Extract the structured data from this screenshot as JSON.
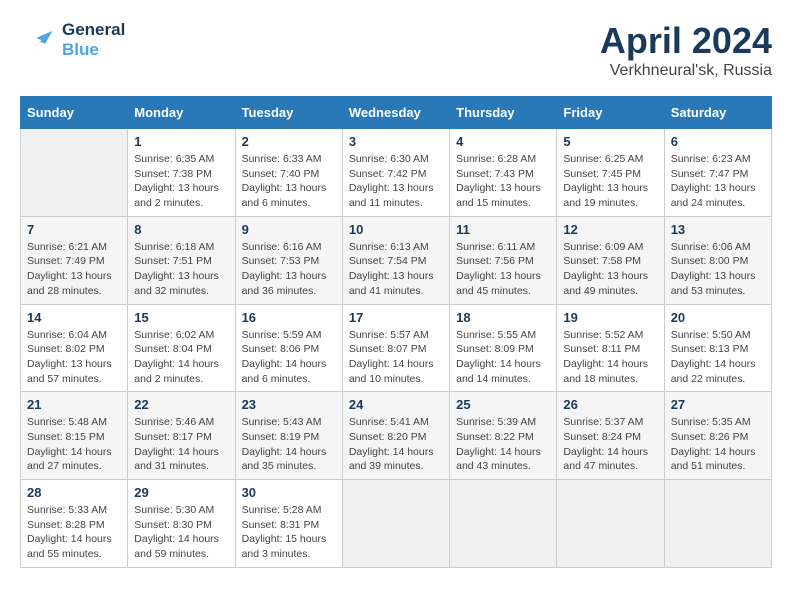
{
  "header": {
    "logo_line1": "General",
    "logo_line2": "Blue",
    "month": "April 2024",
    "location": "Verkhneural'sk, Russia"
  },
  "weekdays": [
    "Sunday",
    "Monday",
    "Tuesday",
    "Wednesday",
    "Thursday",
    "Friday",
    "Saturday"
  ],
  "weeks": [
    [
      {
        "day": "",
        "info": ""
      },
      {
        "day": "1",
        "sunrise": "6:35 AM",
        "sunset": "7:38 PM",
        "daylight": "13 hours and 2 minutes."
      },
      {
        "day": "2",
        "sunrise": "6:33 AM",
        "sunset": "7:40 PM",
        "daylight": "13 hours and 6 minutes."
      },
      {
        "day": "3",
        "sunrise": "6:30 AM",
        "sunset": "7:42 PM",
        "daylight": "13 hours and 11 minutes."
      },
      {
        "day": "4",
        "sunrise": "6:28 AM",
        "sunset": "7:43 PM",
        "daylight": "13 hours and 15 minutes."
      },
      {
        "day": "5",
        "sunrise": "6:25 AM",
        "sunset": "7:45 PM",
        "daylight": "13 hours and 19 minutes."
      },
      {
        "day": "6",
        "sunrise": "6:23 AM",
        "sunset": "7:47 PM",
        "daylight": "13 hours and 24 minutes."
      }
    ],
    [
      {
        "day": "7",
        "sunrise": "6:21 AM",
        "sunset": "7:49 PM",
        "daylight": "13 hours and 28 minutes."
      },
      {
        "day": "8",
        "sunrise": "6:18 AM",
        "sunset": "7:51 PM",
        "daylight": "13 hours and 32 minutes."
      },
      {
        "day": "9",
        "sunrise": "6:16 AM",
        "sunset": "7:53 PM",
        "daylight": "13 hours and 36 minutes."
      },
      {
        "day": "10",
        "sunrise": "6:13 AM",
        "sunset": "7:54 PM",
        "daylight": "13 hours and 41 minutes."
      },
      {
        "day": "11",
        "sunrise": "6:11 AM",
        "sunset": "7:56 PM",
        "daylight": "13 hours and 45 minutes."
      },
      {
        "day": "12",
        "sunrise": "6:09 AM",
        "sunset": "7:58 PM",
        "daylight": "13 hours and 49 minutes."
      },
      {
        "day": "13",
        "sunrise": "6:06 AM",
        "sunset": "8:00 PM",
        "daylight": "13 hours and 53 minutes."
      }
    ],
    [
      {
        "day": "14",
        "sunrise": "6:04 AM",
        "sunset": "8:02 PM",
        "daylight": "13 hours and 57 minutes."
      },
      {
        "day": "15",
        "sunrise": "6:02 AM",
        "sunset": "8:04 PM",
        "daylight": "14 hours and 2 minutes."
      },
      {
        "day": "16",
        "sunrise": "5:59 AM",
        "sunset": "8:06 PM",
        "daylight": "14 hours and 6 minutes."
      },
      {
        "day": "17",
        "sunrise": "5:57 AM",
        "sunset": "8:07 PM",
        "daylight": "14 hours and 10 minutes."
      },
      {
        "day": "18",
        "sunrise": "5:55 AM",
        "sunset": "8:09 PM",
        "daylight": "14 hours and 14 minutes."
      },
      {
        "day": "19",
        "sunrise": "5:52 AM",
        "sunset": "8:11 PM",
        "daylight": "14 hours and 18 minutes."
      },
      {
        "day": "20",
        "sunrise": "5:50 AM",
        "sunset": "8:13 PM",
        "daylight": "14 hours and 22 minutes."
      }
    ],
    [
      {
        "day": "21",
        "sunrise": "5:48 AM",
        "sunset": "8:15 PM",
        "daylight": "14 hours and 27 minutes."
      },
      {
        "day": "22",
        "sunrise": "5:46 AM",
        "sunset": "8:17 PM",
        "daylight": "14 hours and 31 minutes."
      },
      {
        "day": "23",
        "sunrise": "5:43 AM",
        "sunset": "8:19 PM",
        "daylight": "14 hours and 35 minutes."
      },
      {
        "day": "24",
        "sunrise": "5:41 AM",
        "sunset": "8:20 PM",
        "daylight": "14 hours and 39 minutes."
      },
      {
        "day": "25",
        "sunrise": "5:39 AM",
        "sunset": "8:22 PM",
        "daylight": "14 hours and 43 minutes."
      },
      {
        "day": "26",
        "sunrise": "5:37 AM",
        "sunset": "8:24 PM",
        "daylight": "14 hours and 47 minutes."
      },
      {
        "day": "27",
        "sunrise": "5:35 AM",
        "sunset": "8:26 PM",
        "daylight": "14 hours and 51 minutes."
      }
    ],
    [
      {
        "day": "28",
        "sunrise": "5:33 AM",
        "sunset": "8:28 PM",
        "daylight": "14 hours and 55 minutes."
      },
      {
        "day": "29",
        "sunrise": "5:30 AM",
        "sunset": "8:30 PM",
        "daylight": "14 hours and 59 minutes."
      },
      {
        "day": "30",
        "sunrise": "5:28 AM",
        "sunset": "8:31 PM",
        "daylight": "15 hours and 3 minutes."
      },
      {
        "day": "",
        "info": ""
      },
      {
        "day": "",
        "info": ""
      },
      {
        "day": "",
        "info": ""
      },
      {
        "day": "",
        "info": ""
      }
    ]
  ]
}
